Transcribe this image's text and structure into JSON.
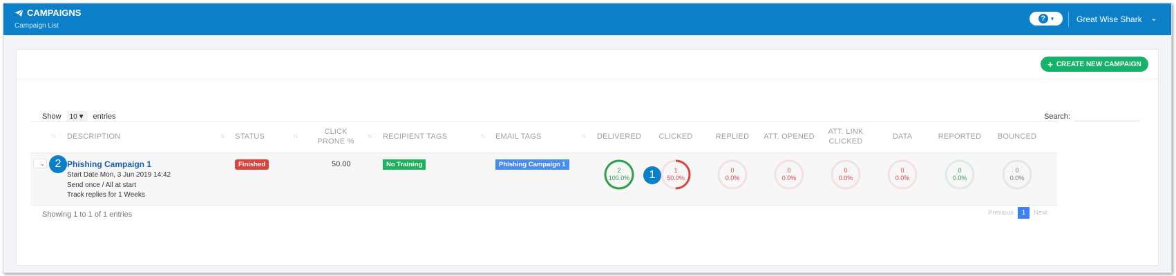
{
  "header": {
    "title": "CAMPAIGNS",
    "subtitle": "Campaign List",
    "help_label": "?",
    "user_name": "Great Wise Shark"
  },
  "toolbar": {
    "create_label": "CREATE NEW CAMPAIGN"
  },
  "table_controls": {
    "show_label": "Show",
    "entries_value": "10",
    "entries_label": "entries",
    "search_label": "Search:",
    "search_value": ""
  },
  "columns": {
    "description": "DESCRIPTION",
    "status": "STATUS",
    "click_prone": "CLICK PRONE %",
    "recipient_tags": "RECIPIENT TAGS",
    "email_tags": "EMAIL TAGS",
    "delivered": "DELIVERED",
    "clicked": "CLICKED",
    "replied": "REPLIED",
    "att_opened": "ATT. OPENED",
    "att_link_clicked": "ATT. LINK CLICKED",
    "data": "DATA",
    "reported": "REPORTED",
    "bounced": "BOUNCED"
  },
  "row": {
    "name": "Phishing Campaign 1",
    "start_date": "Start Date Mon, 3 Jun 2019 14:42",
    "send_mode": "Send once / All at start",
    "track": "Track replies for 1 Weeks",
    "status": "Finished",
    "click_prone": "50.00",
    "recipient_tag": "No Training",
    "email_tag": "Phishing Campaign 1",
    "stats": [
      {
        "key": "delivered",
        "count": "2",
        "pct": "100.0%",
        "fraction": 1.0,
        "color": "#2e9e48"
      },
      {
        "key": "clicked",
        "count": "1",
        "pct": "50.0%",
        "fraction": 0.5,
        "color": "#d9443e"
      },
      {
        "key": "replied",
        "count": "0",
        "pct": "0.0%",
        "fraction": 0,
        "color": "#d9443e"
      },
      {
        "key": "att_opened",
        "count": "0",
        "pct": "0.0%",
        "fraction": 0,
        "color": "#d9443e"
      },
      {
        "key": "att_link_clicked",
        "count": "0",
        "pct": "0.0%",
        "fraction": 0,
        "color": "#d9443e"
      },
      {
        "key": "data",
        "count": "0",
        "pct": "0.0%",
        "fraction": 0,
        "color": "#d9443e"
      },
      {
        "key": "reported",
        "count": "0",
        "pct": "0.0%",
        "fraction": 0,
        "color": "#2e9e48"
      },
      {
        "key": "bounced",
        "count": "0",
        "pct": "0.0%",
        "fraction": 0,
        "color": "#777777"
      }
    ]
  },
  "callouts": {
    "one": "1",
    "two": "2"
  },
  "footer": {
    "showing": "Showing 1 to 1 of 1 entries",
    "previous": "Previous",
    "page": "1",
    "next": "Next"
  },
  "colors": {
    "header": "#0b80c9",
    "create": "#17b26a",
    "link": "#1a5fb4"
  }
}
